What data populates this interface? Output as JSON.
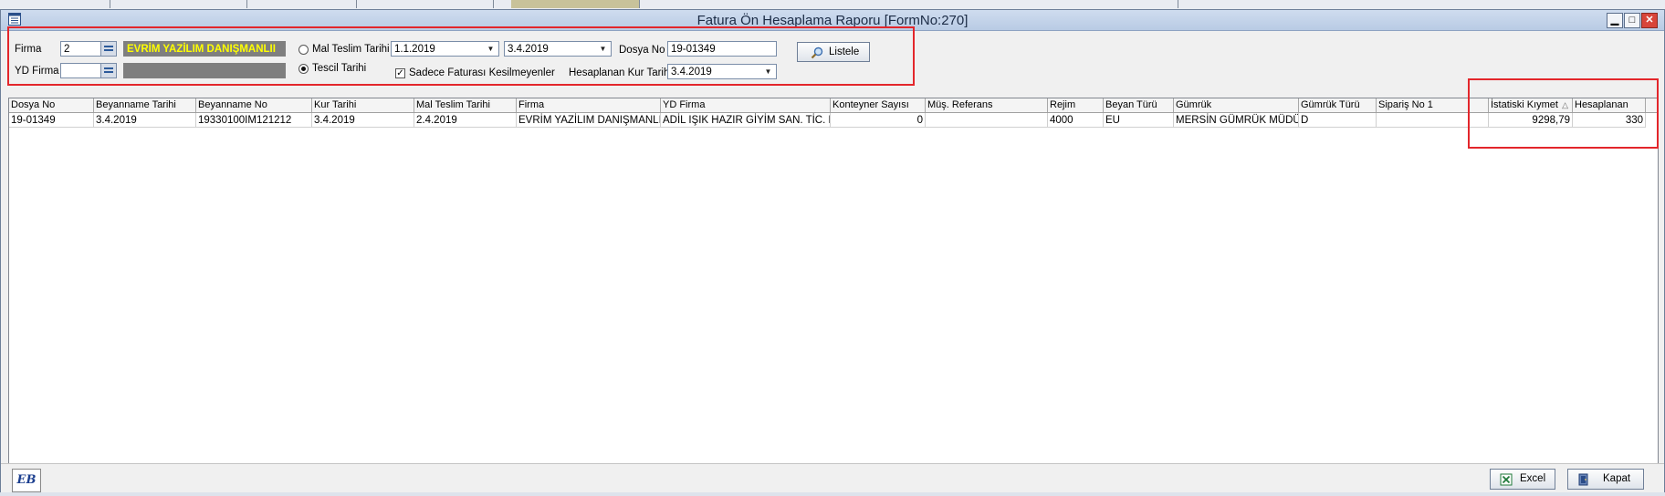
{
  "window": {
    "title": "Fatura Ön Hesaplama Raporu [FormNo:270]"
  },
  "filters": {
    "firma_label": "Firma",
    "firma_value": "2",
    "firma_name": "EVRİM YAZİLIM DANIŞMANLII",
    "yd_firma_label": "YD Firma",
    "yd_firma_value": "",
    "yd_firma_name": "",
    "radio_mal_teslim_label": "Mal Teslim Tarihi",
    "radio_tescil_label": "Tescil Tarihi",
    "selected_radio": "Tescil Tarihi",
    "date_from": "1.1.2019",
    "date_to": "3.4.2019",
    "sadece_label": "Sadece Faturası Kesilmeyenler",
    "sadece_checked": true,
    "dosya_no_label": "Dosya No",
    "dosya_no_value": "19-01349",
    "kur_tarihi_label": "Hesaplanan Kur Tarihi",
    "kur_tarihi_value": "3.4.2019",
    "listele_label": "Listele"
  },
  "table": {
    "columns": [
      "Dosya No",
      "Beyanname Tarihi",
      "Beyanname No",
      "Kur Tarihi",
      "Mal Teslim Tarihi",
      "Firma",
      "YD Firma",
      "Konteyner Sayısı",
      "Müş. Referans",
      "Rejim",
      "Beyan Türü",
      "Gümrük",
      "Gümrük Türü",
      "Sipariş No 1",
      "İstatiski Kıymet",
      "Hesaplanan"
    ],
    "sort_column": "İstatiski Kıymet",
    "rows": [
      [
        "19-01349",
        "3.4.2019",
        "19330100IM121212",
        "3.4.2019",
        "2.4.2019",
        "EVRİM YAZİLIM DANIŞMANLIK",
        "ADİL IŞIK HAZIR GİYİM SAN. TİC. LT",
        "0",
        "",
        "4000",
        "EU",
        "MERSİN GÜMRÜK MÜDÜF",
        "D",
        "",
        "9298,79",
        "330"
      ]
    ]
  },
  "bottom": {
    "excel_label": "Excel",
    "kapat_label": "Kapat",
    "logo_text": "EB"
  },
  "colors": {
    "highlight_red": "#e3262b",
    "firma_name_text": "#ffff00",
    "firma_name_bg": "#7f7f7f"
  }
}
